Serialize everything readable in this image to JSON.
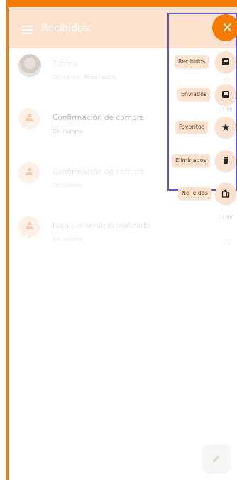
{
  "appbar": {
    "title": "Recibidos"
  },
  "messages": [
    {
      "subject": "Tutoria",
      "from": "De: Antonio Pérez Castillo",
      "date": "",
      "starred": false
    },
    {
      "subject": "Confirmación de compra",
      "from": "De: Sistema",
      "date": "21 abr",
      "starred": false
    },
    {
      "subject": "Confirmación de compra",
      "from": "De: Sistema",
      "date": "",
      "starred": false
    },
    {
      "subject": "Baja del servicio realizado",
      "from": "De: Sistema",
      "date": "11 abr",
      "starred": false
    }
  ],
  "speed_dial": {
    "actions": [
      {
        "label": "Recibidos",
        "icon": "inbox-icon"
      },
      {
        "label": "Enviados",
        "icon": "outbox-icon"
      },
      {
        "label": "Favoritos",
        "icon": "star-icon"
      },
      {
        "label": "Eliminados",
        "icon": "trash-icon"
      },
      {
        "label": "No leidos",
        "icon": "mailbox-icon"
      }
    ]
  },
  "colors": {
    "accent": "#f57c00",
    "appbar": "#fde3cf",
    "highlight": "#5a56c4"
  },
  "glyphs": {
    "close": "×",
    "star_outline": "☆"
  }
}
